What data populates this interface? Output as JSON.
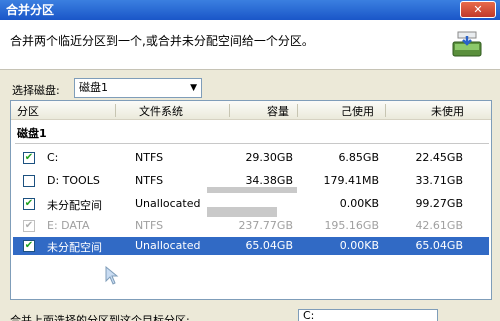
{
  "window": {
    "title": "合并分区",
    "close_label": "✕"
  },
  "header": {
    "description": "合并两个临近分区到一个,或合并未分配空间给一个分区。"
  },
  "disk_selector": {
    "label": "选择磁盘:",
    "value": "磁盘1"
  },
  "table": {
    "columns": [
      "分区",
      "文件系统",
      "容量",
      "己使用",
      "未使用"
    ],
    "group": "磁盘1",
    "rows": [
      {
        "checked": "✔",
        "partition": "C:",
        "fs": "NTFS",
        "capacity": "29.30GB",
        "used": "6.85GB",
        "unused": "22.45GB"
      },
      {
        "checked": "",
        "partition": "D: TOOLS",
        "fs": "NTFS",
        "capacity": "34.38GB",
        "used": "179.41MB",
        "unused": "33.71GB"
      },
      {
        "checked": "✔",
        "partition": "未分配空间",
        "fs": "Unallocated",
        "capacity": "",
        "used": "0.00KB",
        "unused": "99.27GB"
      },
      {
        "checked": "✔",
        "partition": "E: DATA",
        "fs": "NTFS",
        "capacity": "237.77GB",
        "used": "195.16GB",
        "unused": "42.61GB"
      },
      {
        "checked": "✔",
        "partition": "未分配空间",
        "fs": "Unallocated",
        "capacity": "65.04GB",
        "used": "0.00KB",
        "unused": "65.04GB"
      }
    ]
  },
  "bottom": {
    "label": "合并上面选择的分区到这个目标分区:",
    "select_value": "C:"
  }
}
